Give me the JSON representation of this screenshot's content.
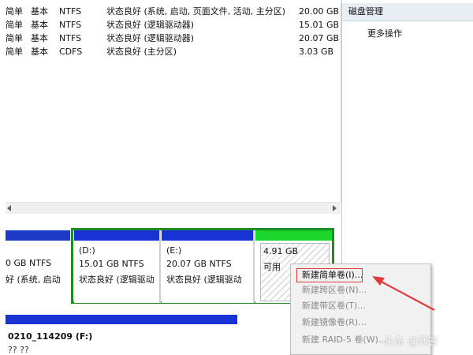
{
  "volume_table": {
    "rows": [
      {
        "layout": "简单",
        "type": "基本",
        "fs": "NTFS",
        "status": "状态良好 (系统, 启动, 页面文件, 活动, 主分区)",
        "capacity": "20.00 GB"
      },
      {
        "layout": "简单",
        "type": "基本",
        "fs": "NTFS",
        "status": "状态良好 (逻辑驱动器)",
        "capacity": "15.01 GB"
      },
      {
        "layout": "简单",
        "type": "基本",
        "fs": "NTFS",
        "status": "状态良好 (逻辑驱动器)",
        "capacity": "20.07 GB"
      },
      {
        "layout": "简单",
        "type": "基本",
        "fs": "CDFS",
        "status": "状态良好 (主分区)",
        "capacity": "3.03 GB"
      }
    ]
  },
  "actions_panel": {
    "header": "磁盘管理",
    "more_actions": "更多操作"
  },
  "disk_map": {
    "partitions": [
      {
        "name": "",
        "size": "0 GB NTFS",
        "status": "好 (系统, 启动"
      },
      {
        "name": "(D:)",
        "size": "15.01 GB NTFS",
        "status": "状态良好 (逻辑驱动"
      },
      {
        "name": "(E:)",
        "size": "20.07 GB NTFS",
        "status": "状态良好 (逻辑驱动"
      },
      {
        "name": "",
        "size": "4.91 GB",
        "status": "可用"
      }
    ],
    "disk2_label": "0210_114209  (F:)",
    "disk2_cut": "?? ??"
  },
  "context_menu": {
    "items": [
      {
        "label": "新建简单卷(I)...",
        "enabled": true
      },
      {
        "label": "新建跨区卷(N)...",
        "enabled": false
      },
      {
        "label": "新建带区卷(T)...",
        "enabled": false
      },
      {
        "label": "新建镜像卷(R)...",
        "enabled": false
      },
      {
        "label": "新建 RAID-5 卷(W)...",
        "enabled": false
      }
    ]
  },
  "watermark": "头条 @问答",
  "colors": {
    "primary_partition": "#1832d6",
    "free_space": "#1dd62b",
    "selection_border": "#1e8c22",
    "annotation": "#e03b3b"
  }
}
